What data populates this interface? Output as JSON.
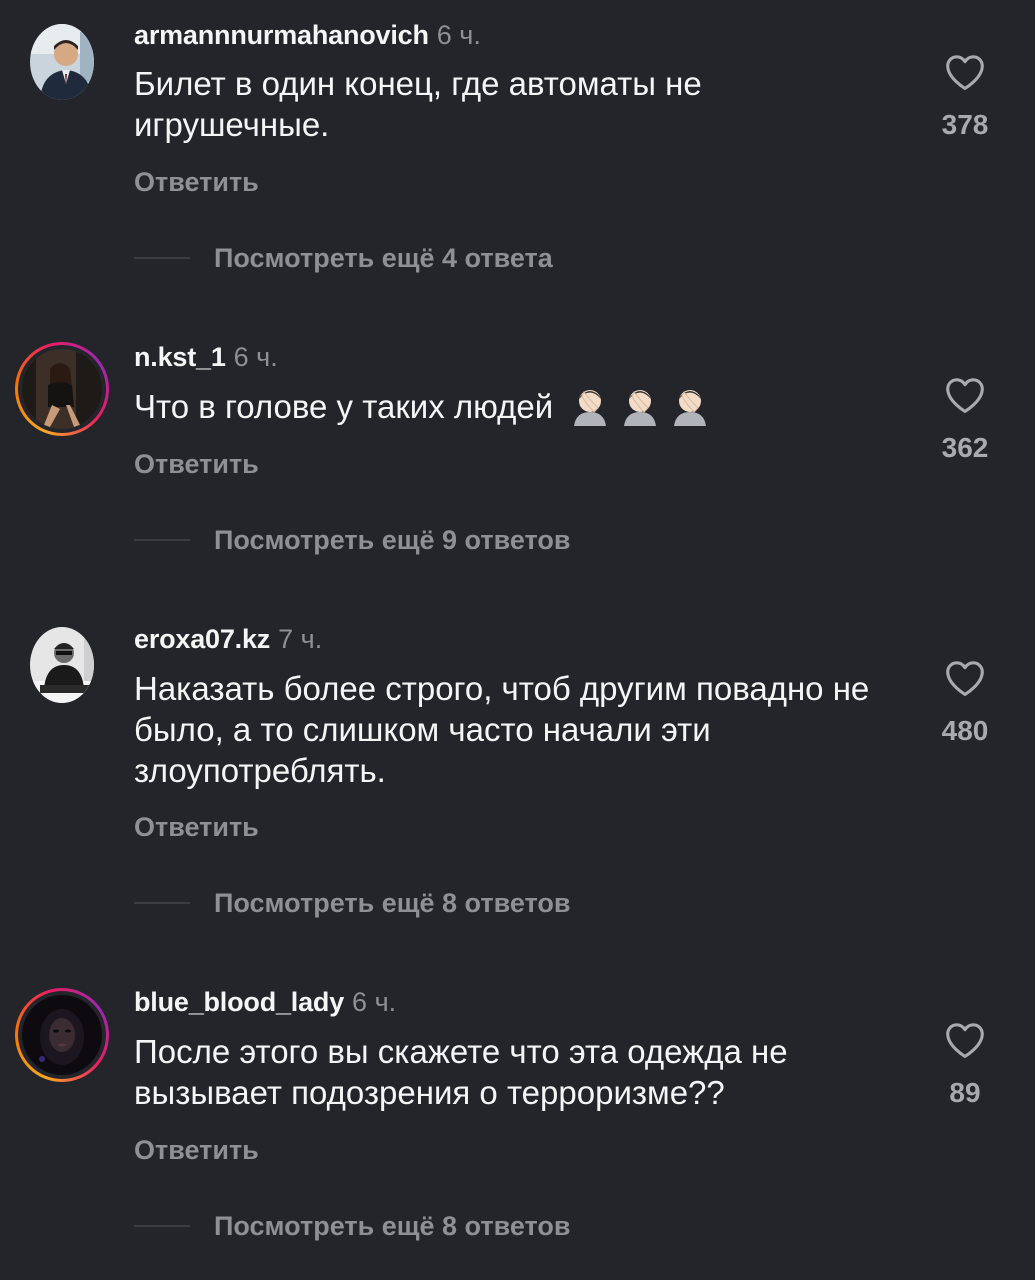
{
  "comments": [
    {
      "username": "armannnurmahanovich",
      "time": "6 ч.",
      "text": "Билет в один конец, где автоматы не игрушечные.",
      "reply_label": "Ответить",
      "replies_label": "Посмотреть ещё 4 ответа",
      "likes": "378",
      "avatar_ring": false,
      "avatar_icon": "profile-photo"
    },
    {
      "username": "n.kst_1",
      "time": "6 ч.",
      "text": "Что в голове  у таких людей",
      "emoji": "facepalm facepalm facepalm",
      "reply_label": "Ответить",
      "replies_label": "Посмотреть ещё 9 ответов",
      "likes": "362",
      "avatar_ring": true,
      "avatar_icon": "profile-photo"
    },
    {
      "username": "eroxa07.kz",
      "time": "7 ч.",
      "text": "Наказать более строго, чтоб другим повадно не было, а то слишком часто начали эти злоупотреблять.",
      "reply_label": "Ответить",
      "replies_label": "Посмотреть ещё 8 ответов",
      "likes": "480",
      "avatar_ring": false,
      "avatar_icon": "profile-photo"
    },
    {
      "username": "blue_blood_lady",
      "time": "6 ч.",
      "text": "После этого вы скажете что эта одежда не вызывает подозрения о терроризме??",
      "reply_label": "Ответить",
      "replies_label": "Посмотреть ещё 8 ответов",
      "likes": "89",
      "avatar_ring": true,
      "avatar_icon": "profile-photo"
    }
  ],
  "icons": {
    "like": "heart-outline-icon"
  },
  "colors": {
    "background": "#23252b",
    "primary_text": "#f5f5f5",
    "secondary_text": "#8e9096",
    "story_ring": [
      "#f9a825",
      "#e91e63",
      "#9c27b0"
    ]
  }
}
